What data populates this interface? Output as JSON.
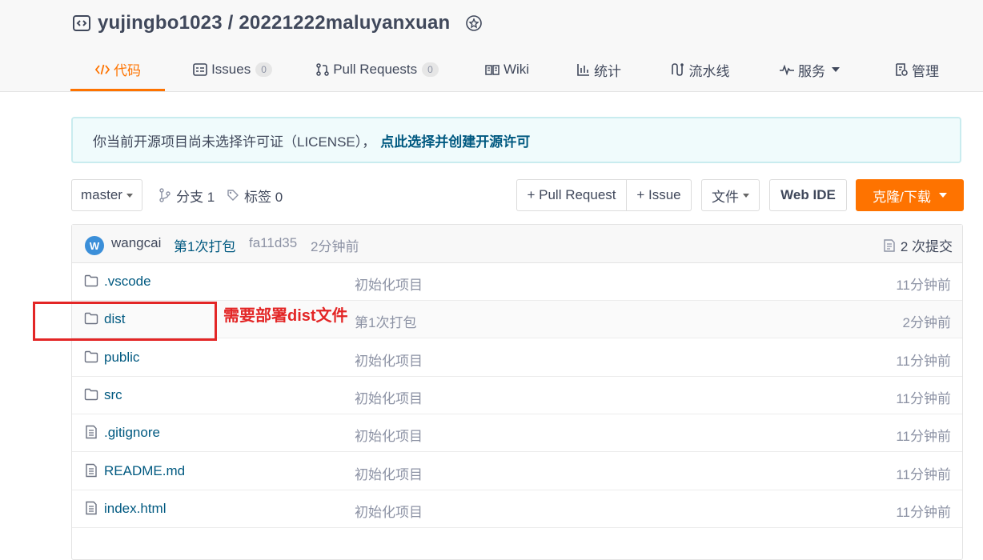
{
  "repo": {
    "title": "yujingbo1023 / 20221222maluyanxuan"
  },
  "tabs": {
    "code": "代码",
    "issues": "Issues",
    "issues_count": "0",
    "pulls": "Pull Requests",
    "pulls_count": "0",
    "wiki": "Wiki",
    "stats": "统计",
    "pipeline": "流水线",
    "service": "服务",
    "manage": "管理"
  },
  "notice": {
    "text": "你当前开源项目尚未选择许可证（LICENSE），",
    "link": "点此选择并创建开源许可"
  },
  "toolbar": {
    "branch": "master",
    "branches": "分支 1",
    "tags": "标签 0",
    "pull_request": "+ Pull Request",
    "issue": "+ Issue",
    "file": "文件",
    "web_ide": "Web IDE",
    "clone": "克隆/下载"
  },
  "commit": {
    "avatar_letter": "W",
    "author": "wangcai",
    "message": "第1次打包",
    "hash": "fa11d35",
    "time": "2分钟前",
    "count": "2 次提交"
  },
  "files": [
    {
      "type": "folder",
      "name": ".vscode",
      "message": "初始化项目",
      "time": "11分钟前"
    },
    {
      "type": "folder",
      "name": "dist",
      "message": "第1次打包",
      "time": "2分钟前"
    },
    {
      "type": "folder",
      "name": "public",
      "message": "初始化项目",
      "time": "11分钟前"
    },
    {
      "type": "folder",
      "name": "src",
      "message": "初始化项目",
      "time": "11分钟前"
    },
    {
      "type": "file",
      "name": ".gitignore",
      "message": "初始化项目",
      "time": "11分钟前"
    },
    {
      "type": "file",
      "name": "README.md",
      "message": "初始化项目",
      "time": "11分钟前"
    },
    {
      "type": "file",
      "name": "index.html",
      "message": "初始化项目",
      "time": "11分钟前"
    }
  ],
  "annotation": {
    "text": "需要部署dist文件"
  },
  "colors": {
    "accent": "#fe7300",
    "link": "#005980",
    "annotation": "#e32626"
  }
}
